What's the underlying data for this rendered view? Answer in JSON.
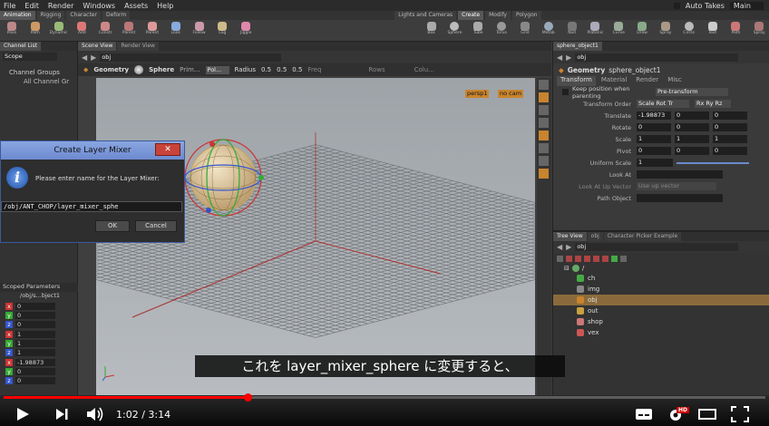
{
  "menubar": {
    "items": [
      "File",
      "Edit",
      "Render",
      "Windows",
      "Assets",
      "Help"
    ],
    "auto_takes": "Auto Takes",
    "main": "Main"
  },
  "shelf": {
    "left_tabs": [
      "Animation",
      "Rigging",
      "Character",
      "Deform"
    ],
    "right_tabs": [
      "Lights and Cameras",
      "Create",
      "Modify",
      "Polygon"
    ],
    "left_tools": [
      "Pose",
      "Path",
      "Dynamic",
      "Add",
      "Constr",
      "Parent",
      "Parent",
      "Look",
      "Follow",
      "Lag",
      "Jiggle"
    ],
    "right_tools": [
      "Box",
      "Sphere",
      "Tube",
      "Torus",
      "Grid",
      "Metab",
      "Null",
      "Platonic",
      "Curve",
      "Draw",
      "Spray",
      "Circle",
      "Text",
      "Path",
      "Spray"
    ]
  },
  "left_pane": {
    "tabs": [
      "Channel List"
    ],
    "scope": "Scope",
    "channel_groups": "Channel Groups",
    "all_channels": "All Channel Gr",
    "scoped_params": "Scoped Parameters",
    "scoped_path": "/obj/s...bject1",
    "channels": [
      {
        "axis": "x",
        "value": "0"
      },
      {
        "axis": "y",
        "value": "0"
      },
      {
        "axis": "z",
        "value": "0"
      },
      {
        "axis": "x",
        "value": "1"
      },
      {
        "axis": "y",
        "value": "1"
      },
      {
        "axis": "z",
        "value": "1"
      },
      {
        "axis": "x",
        "value": "-1.98873"
      },
      {
        "axis": "y",
        "value": "0"
      },
      {
        "axis": "z",
        "value": "0"
      }
    ]
  },
  "viewport": {
    "tabs": [
      "Scene View",
      "Render View"
    ],
    "path": "obj",
    "geo_label": "Geometry",
    "sphere_label": "Sphere",
    "prim_label": "Prim...",
    "pol_label": "Pol...",
    "radius_label": "Radius",
    "radius": [
      "0.5",
      "0.5",
      "0.5"
    ],
    "freq_label": "Freq",
    "rows_label": "Rows",
    "cols_label": "Colu...",
    "persp": "persp1",
    "cam": "no cam"
  },
  "dialog": {
    "title": "Create Layer Mixer",
    "prompt": "Please enter name for the Layer Mixer:",
    "value": "/obj/ANT_CHOP/layer_mixer_sphe",
    "ok": "OK",
    "cancel": "Cancel"
  },
  "params": {
    "tab": "sphere_object1",
    "path": "obj",
    "node_type": "Geometry",
    "node_name": "sphere_object1",
    "tabs": [
      "Transform",
      "Material",
      "Render",
      "Misc"
    ],
    "keep_pos": "Keep position when parenting",
    "pre_transform": "Pre-transform",
    "transform_order_label": "Transform Order",
    "transform_order": "Scale Rot Tr",
    "rot_order": "Rx Ry Rz",
    "rows": [
      {
        "label": "Translate",
        "v": [
          "-1.98873",
          "0",
          "0"
        ]
      },
      {
        "label": "Rotate",
        "v": [
          "0",
          "0",
          "0"
        ]
      },
      {
        "label": "Scale",
        "v": [
          "1",
          "1",
          "1"
        ]
      },
      {
        "label": "Pivot",
        "v": [
          "0",
          "0",
          "0"
        ]
      }
    ],
    "uniform_scale_label": "Uniform Scale",
    "uniform_scale": "1",
    "look_at": "Look At",
    "look_up": "Look At Up Vector",
    "look_up_val": "Use up vector",
    "path_object": "Path Object"
  },
  "network": {
    "tabs": [
      "Tree View",
      "obj",
      "Character Picker Example"
    ],
    "path": "obj",
    "root": "/",
    "items": [
      "ch",
      "img",
      "obj",
      "out",
      "shop",
      "vex"
    ]
  },
  "subtitle": "これを layer_mixer_sphere に変更すると、",
  "player": {
    "time": "1:02 / 3:14",
    "progress": 0.32,
    "hd": "HD"
  },
  "colors": {
    "accent": "#ff0000",
    "dialog_title": "#6a86c8",
    "selection": "#8a6a3c"
  }
}
